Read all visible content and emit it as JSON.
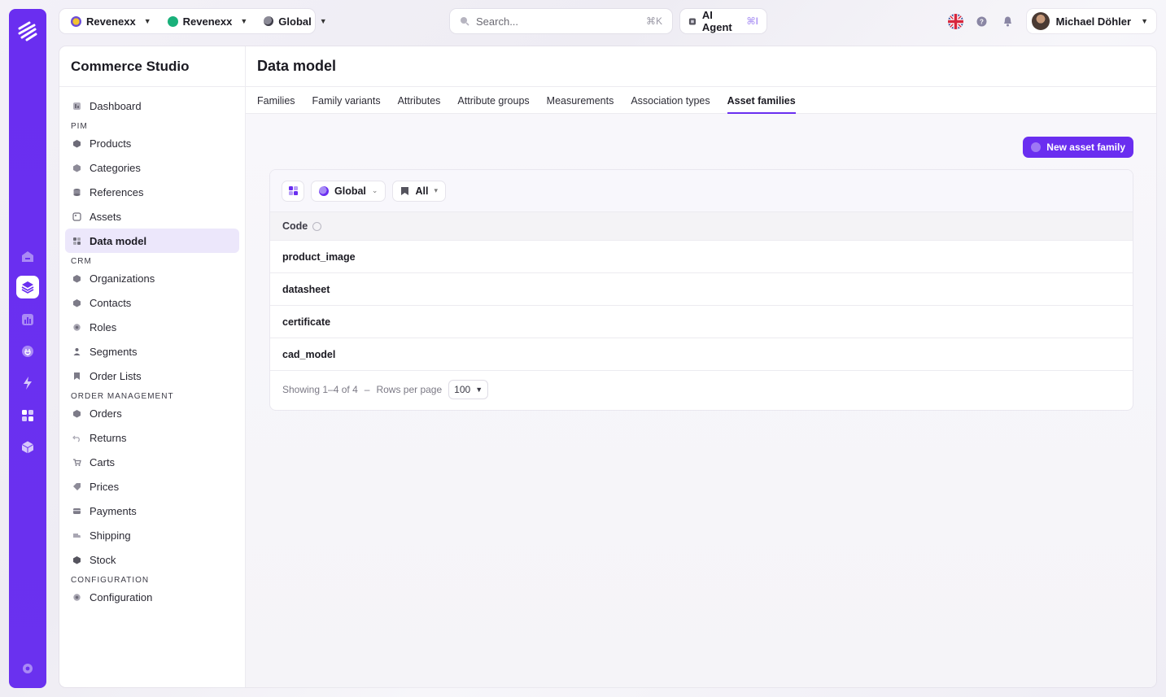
{
  "colors": {
    "brand": "#6a2ef0",
    "active_bg": "#ece7fb",
    "workspace_green": "#19b07a"
  },
  "topbar": {
    "tenant": "Revenexx",
    "workspace": "Revenexx",
    "scope": "Global",
    "search": {
      "placeholder": "Search...",
      "shortcut": "⌘K"
    },
    "agent": {
      "label": "AI Agent",
      "shortcut": "⌘I"
    },
    "user": {
      "name": "Michael Döhler"
    }
  },
  "sidebar": {
    "title": "Commerce Studio",
    "dashboard": "Dashboard",
    "sections": [
      {
        "label": "PIM",
        "items": [
          "Products",
          "Categories",
          "References",
          "Assets",
          "Data model"
        ]
      },
      {
        "label": "CRM",
        "items": [
          "Organizations",
          "Contacts",
          "Roles",
          "Segments",
          "Order Lists"
        ]
      },
      {
        "label": "ORDER MANAGEMENT",
        "items": [
          "Orders",
          "Returns",
          "Carts",
          "Prices",
          "Payments",
          "Shipping",
          "Stock"
        ]
      },
      {
        "label": "CONFIGURATION",
        "items": [
          "Configuration"
        ]
      }
    ],
    "active": "Data model"
  },
  "main": {
    "title": "Data model",
    "tabs": [
      "Families",
      "Family variants",
      "Attributes",
      "Attribute groups",
      "Measurements",
      "Association types",
      "Asset families"
    ],
    "active_tab": "Asset families",
    "new_button": "New asset family",
    "filters": {
      "scope": "Global",
      "view": "All"
    },
    "table": {
      "columns": [
        "Code"
      ],
      "rows": [
        "product_image",
        "datasheet",
        "certificate",
        "cad_model"
      ]
    },
    "pagination": {
      "showing": "Showing 1–4 of 4",
      "separator": "–",
      "rows_label": "Rows per page",
      "rows_value": "100"
    }
  }
}
